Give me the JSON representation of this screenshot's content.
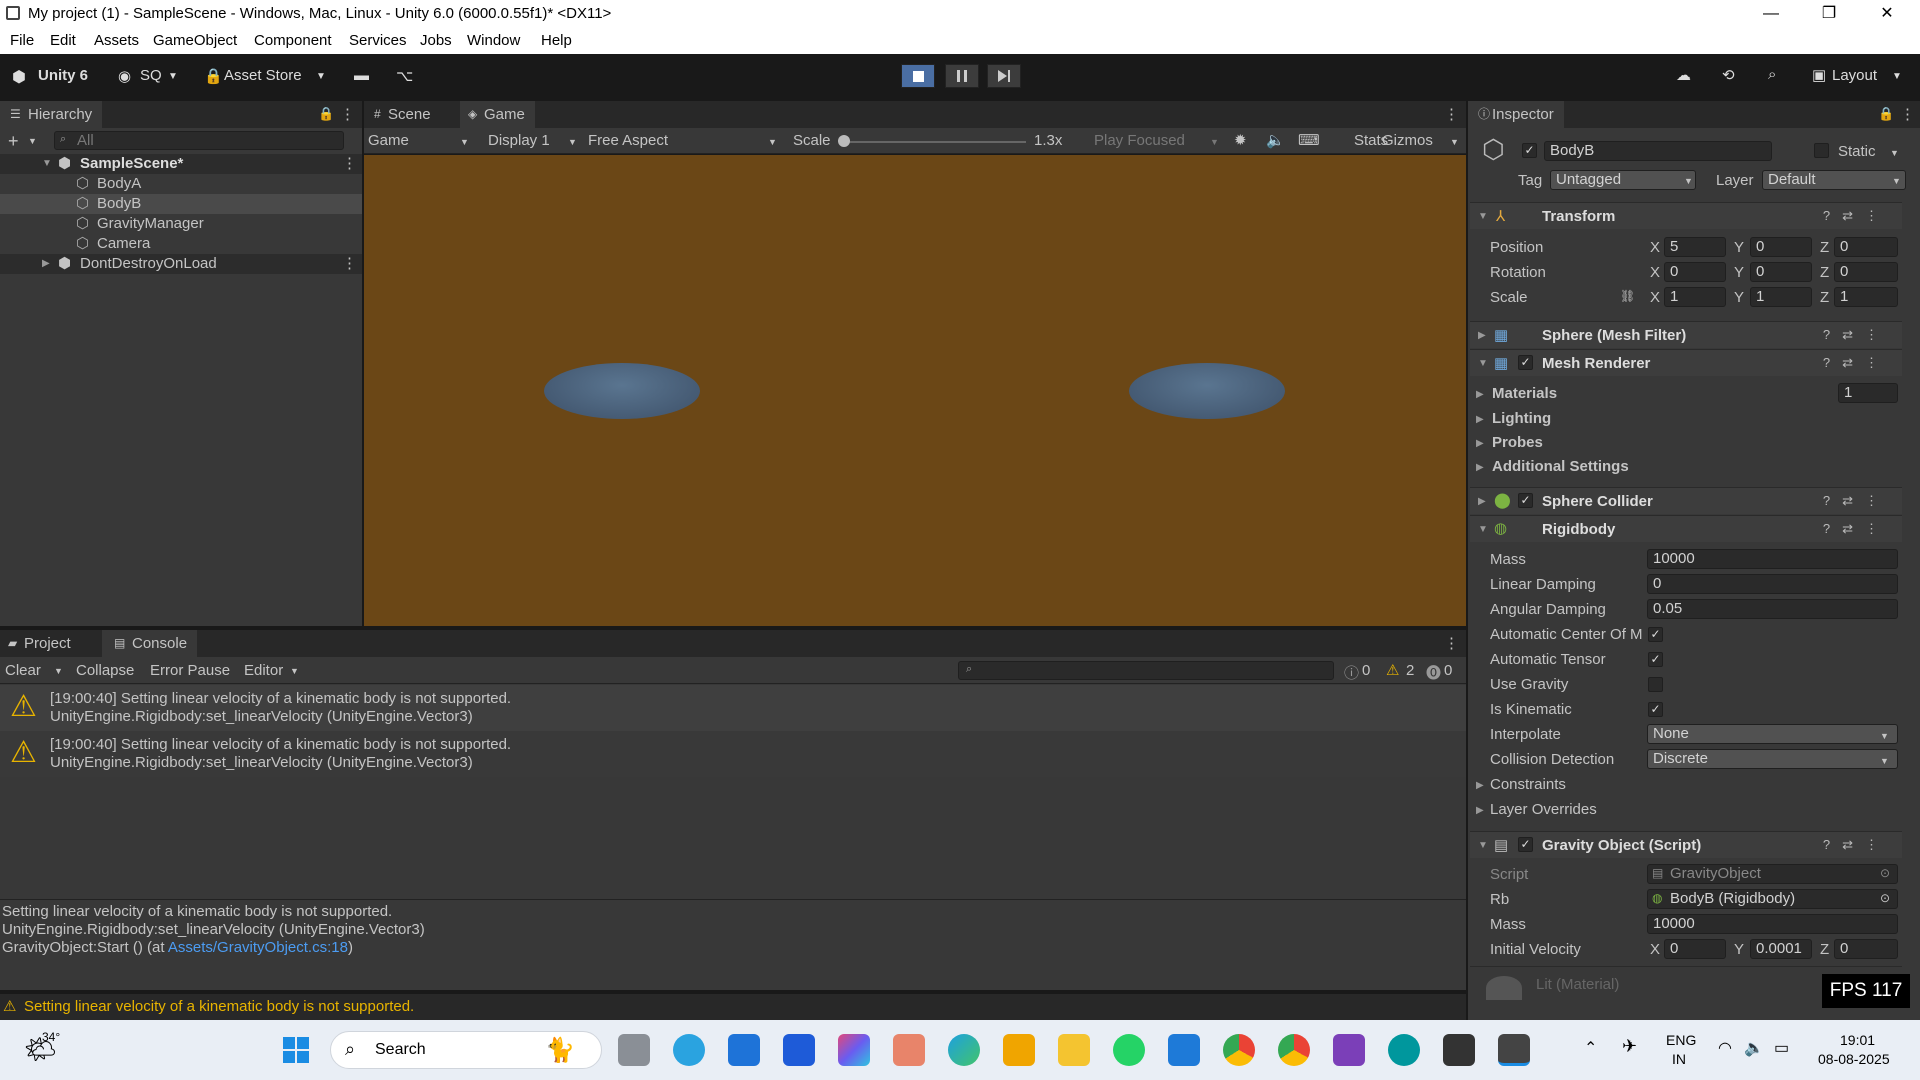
{
  "window": {
    "title": "My project (1) - SampleScene - Windows, Mac, Linux - Unity 6.0 (6000.0.55f1)* <DX11>",
    "min": "—",
    "max": "❐",
    "close": "✕"
  },
  "menu": [
    "File",
    "Edit",
    "Assets",
    "GameObject",
    "Component",
    "Services",
    "Jobs",
    "Window",
    "Help"
  ],
  "toolbar": {
    "unity": "Unity 6",
    "account": "SQ",
    "asset_store": "Asset Store",
    "layout": "Layout"
  },
  "hierarchy": {
    "tab": "Hierarchy",
    "search_placeholder": "All",
    "scene": "SampleScene*",
    "items": [
      "BodyA",
      "BodyB",
      "GravityManager",
      "Camera"
    ],
    "ddol": "DontDestroyOnLoad"
  },
  "game": {
    "tab_scene": "Scene",
    "tab_game": "Game",
    "view": "Game",
    "display": "Display 1",
    "aspect": "Free Aspect",
    "scale_label": "Scale",
    "scale_value": "1.3x",
    "play_focused": "Play Focused",
    "stats": "Stats",
    "gizmos": "Gizmos",
    "bg": "#6b4716"
  },
  "console": {
    "tab_project": "Project",
    "tab_console": "Console",
    "clear": "Clear",
    "collapse": "Collapse",
    "error_pause": "Error Pause",
    "editor": "Editor",
    "count_info": "0",
    "count_warn": "2",
    "count_err": "0",
    "entries": [
      {
        "line1": "[19:00:40] Setting linear velocity of a kinematic body is not supported.",
        "line2": "UnityEngine.Rigidbody:set_linearVelocity (UnityEngine.Vector3)"
      },
      {
        "line1": "[19:00:40] Setting linear velocity of a kinematic body is not supported.",
        "line2": "UnityEngine.Rigidbody:set_linearVelocity (UnityEngine.Vector3)"
      }
    ],
    "detail1": "Setting linear velocity of a kinematic body is not supported.",
    "detail2": "UnityEngine.Rigidbody:set_linearVelocity (UnityEngine.Vector3)",
    "detail3a": "GravityObject:Start () (at ",
    "detail3link": "Assets/GravityObject.cs:18",
    "detail3b": ")"
  },
  "status": "Setting linear velocity of a kinematic body is not supported.",
  "inspector": {
    "tab": "Inspector",
    "name": "BodyB",
    "static": "Static",
    "tag_label": "Tag",
    "tag": "Untagged",
    "layer_label": "Layer",
    "layer": "Default",
    "transform": "Transform",
    "position": "Position",
    "rotation": "Rotation",
    "scale": "Scale",
    "pos": [
      "5",
      "0",
      "0"
    ],
    "rot": [
      "0",
      "0",
      "0"
    ],
    "scl": [
      "1",
      "1",
      "1"
    ],
    "x": "X",
    "y": "Y",
    "z": "Z",
    "mesh_filter": "Sphere (Mesh Filter)",
    "mesh_renderer": "Mesh Renderer",
    "materials": "Materials",
    "materials_count": "1",
    "lighting": "Lighting",
    "probes": "Probes",
    "additional": "Additional Settings",
    "sphere_collider": "Sphere Collider",
    "rigidbody": "Rigidbody",
    "mass_l": "Mass",
    "mass": "10000",
    "lin_l": "Linear Damping",
    "lin": "0",
    "ang_l": "Angular Damping",
    "ang": "0.05",
    "acom_l": "Automatic Center Of Mass",
    "aten_l": "Automatic Tensor",
    "grav_l": "Use Gravity",
    "kin_l": "Is Kinematic",
    "interp_l": "Interpolate",
    "interp": "None",
    "coll_l": "Collision Detection",
    "coll": "Discrete",
    "constraints": "Constraints",
    "layer_overrides": "Layer Overrides",
    "gravity_script": "Gravity Object (Script)",
    "script_l": "Script",
    "script": "GravityObject",
    "rb_l": "Rb",
    "rb": "BodyB (Rigidbody)",
    "gmass_l": "Mass",
    "gmass": "10000",
    "iv_l": "Initial Velocity",
    "iv": [
      "0",
      "0.0001",
      "0"
    ],
    "lit": "Lit (Material)",
    "fps": "FPS 117"
  },
  "taskbar": {
    "temp": "34°",
    "search": "Search",
    "lang1": "ENG",
    "lang2": "IN",
    "time": "19:01",
    "date": "08-08-2025"
  }
}
